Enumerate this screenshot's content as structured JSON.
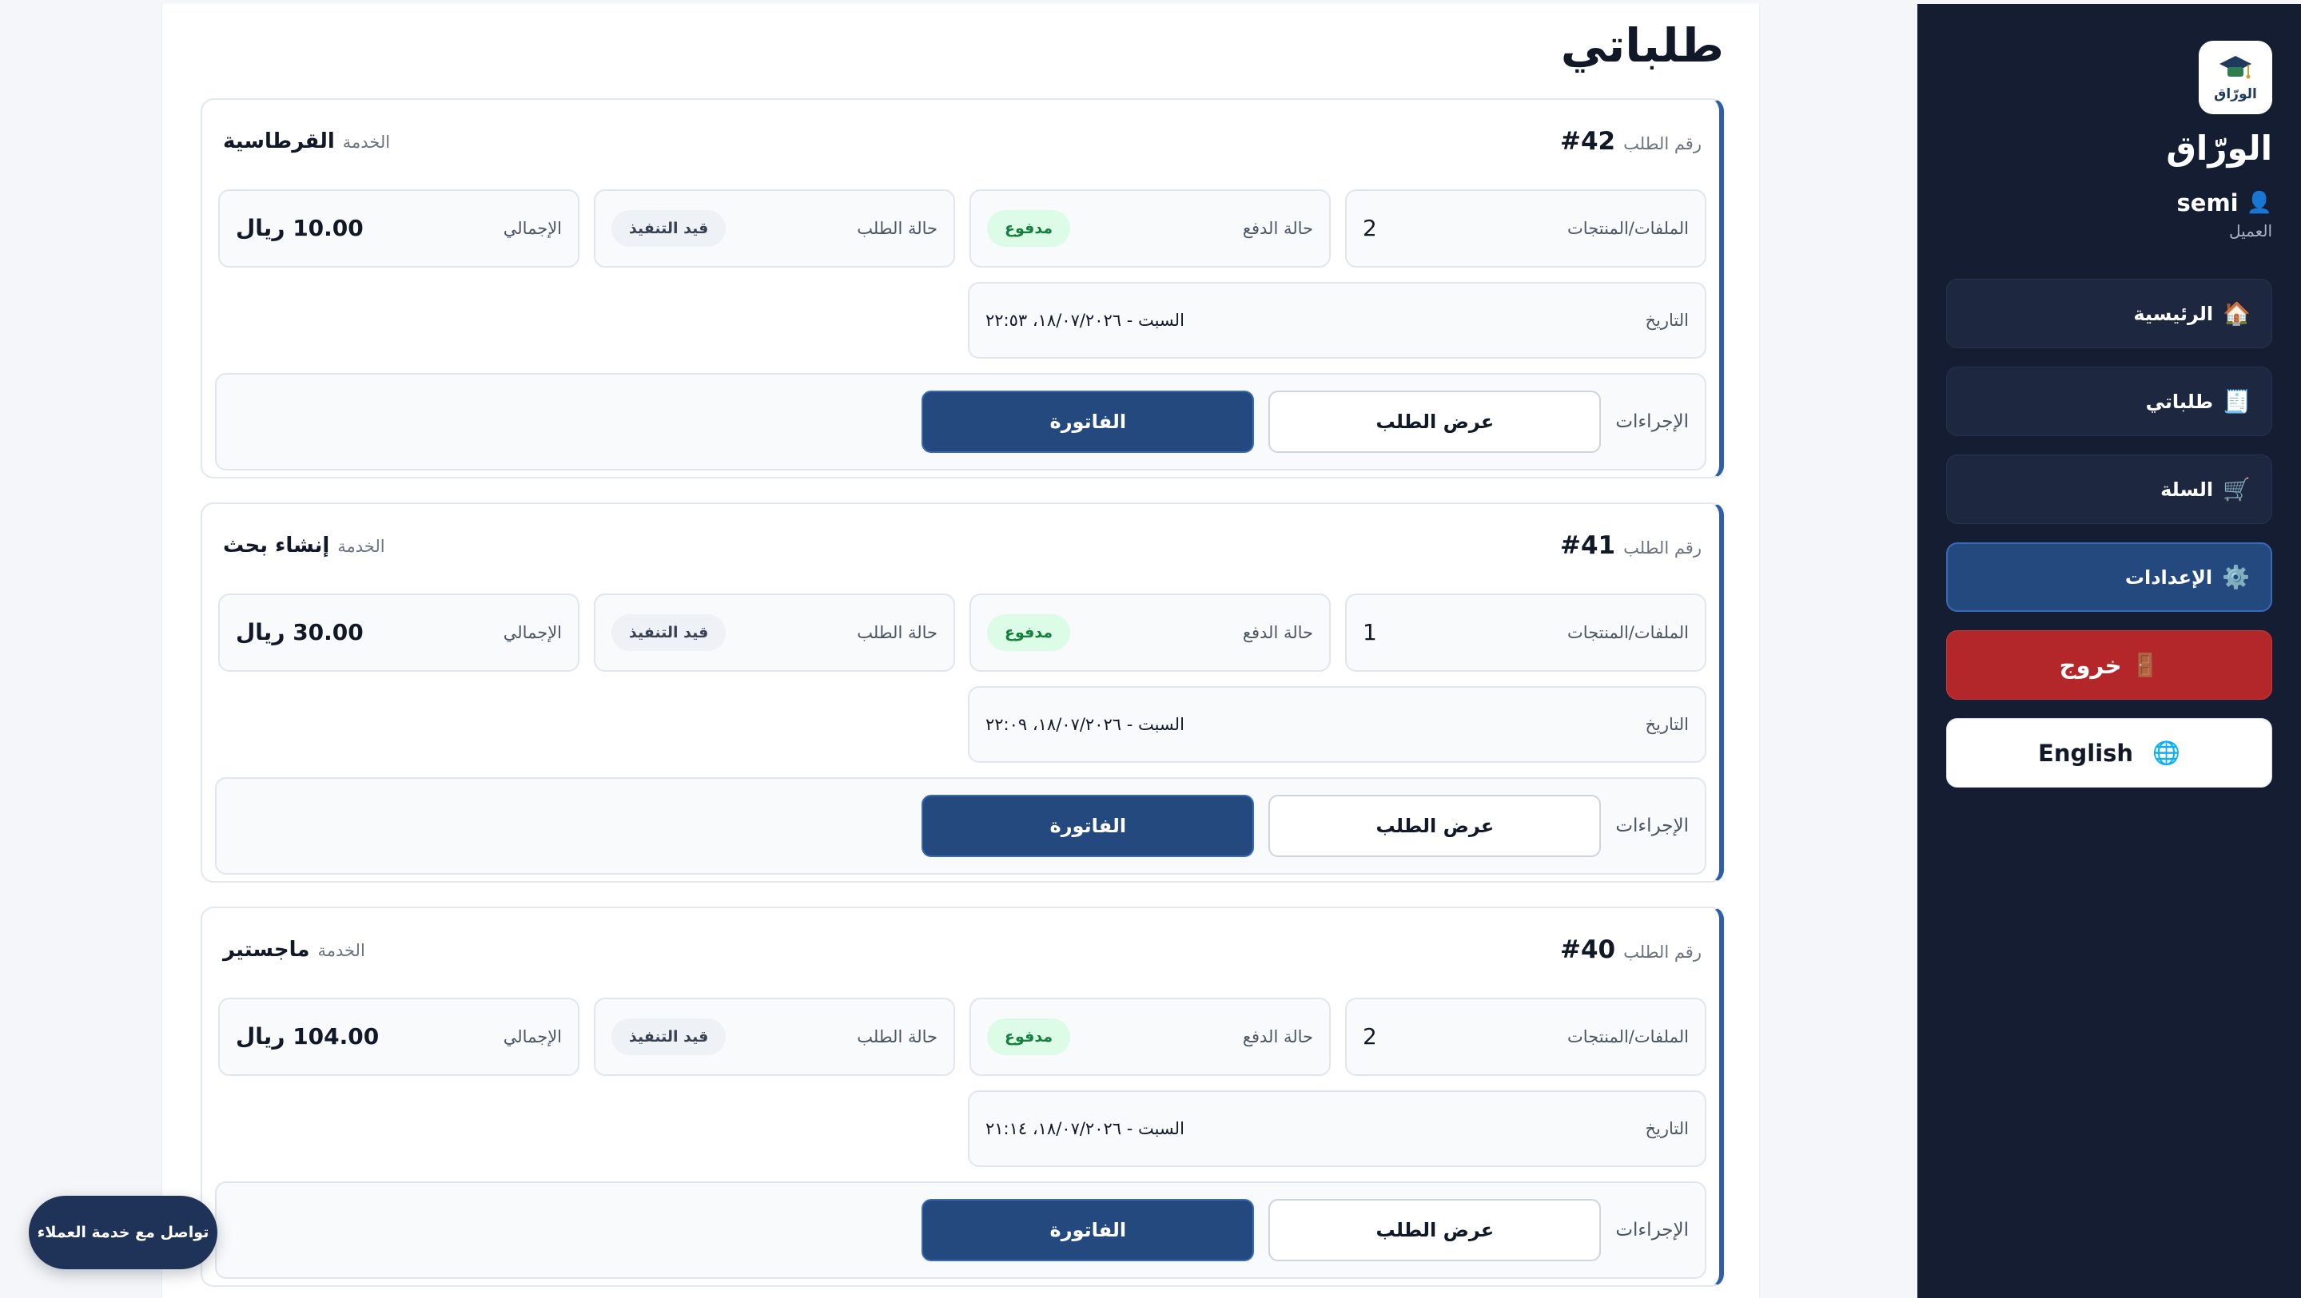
{
  "sidebar": {
    "logo_text": "الورّاق",
    "brand": "الورّاق",
    "user": {
      "icon": "user-icon",
      "name": "semi",
      "role": "العميل"
    },
    "nav": [
      {
        "icon": "home-icon",
        "glyph": "🏠",
        "label": "الرئيسية"
      },
      {
        "icon": "receipt-icon",
        "glyph": "🧾",
        "label": "طلباتي"
      },
      {
        "icon": "cart-icon",
        "glyph": "🛒",
        "label": "السلة"
      },
      {
        "icon": "gear-icon",
        "glyph": "⚙️",
        "label": "الإعدادات"
      },
      {
        "icon": "door-icon",
        "glyph": "🚪",
        "label": "خروج"
      },
      {
        "icon": "globe-icon",
        "glyph": "🌐",
        "label": "English"
      }
    ]
  },
  "main": {
    "title": "طلباتي",
    "labels": {
      "order_number": "رقم الطلب",
      "service": "الخدمة",
      "files": "الملفات/المنتجات",
      "payment_status": "حالة الدفع",
      "order_status": "حالة الطلب",
      "total": "الإجمالي",
      "date": "التاريخ",
      "actions": "الإجراءات",
      "view_order": "عرض الطلب",
      "invoice": "الفاتورة"
    },
    "orders": [
      {
        "number": "#42",
        "service": "القرطاسية",
        "files": "2",
        "payment_status": "مدفوع",
        "order_status": "قيد التنفيذ",
        "total": "10.00 ريال",
        "date": "السبت - ١٨/٠٧/٢٠٢٦، ٢٢:٥٣"
      },
      {
        "number": "#41",
        "service": "إنشاء بحث",
        "files": "1",
        "payment_status": "مدفوع",
        "order_status": "قيد التنفيذ",
        "total": "30.00 ريال",
        "date": "السبت - ١٨/٠٧/٢٠٢٦، ٢٢:٠٩"
      },
      {
        "number": "#40",
        "service": "ماجستير",
        "files": "2",
        "payment_status": "مدفوع",
        "order_status": "قيد التنفيذ",
        "total": "104.00 ريال",
        "date": "السبت - ١٨/٠٧/٢٠٢٦، ٢١:١٤"
      }
    ]
  },
  "support_button": "تواصل مع خدمة العملاء",
  "colors": {
    "sidebar_bg": "#151d33",
    "primary": "#24497f",
    "danger": "#b3272b",
    "accent_border": "#2e5ea8",
    "paid_badge_bg": "#dcfce7",
    "paid_badge_text": "#15803d"
  }
}
